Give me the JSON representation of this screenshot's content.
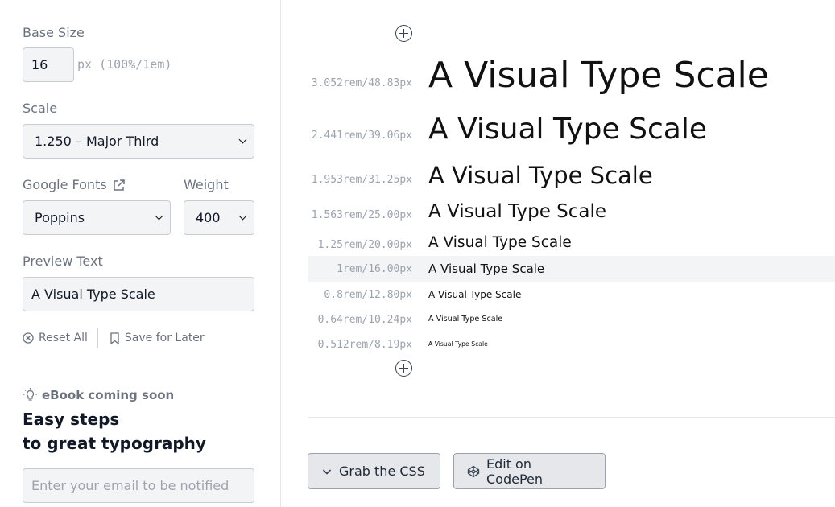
{
  "sidebar": {
    "base_size": {
      "label": "Base Size",
      "value": "16",
      "unit": "px (100%/1em)"
    },
    "scale": {
      "label": "Scale",
      "selected": "1.250 – Major Third"
    },
    "font": {
      "label": "Google Fonts",
      "selected": "Poppins"
    },
    "weight": {
      "label": "Weight",
      "selected": "400"
    },
    "preview": {
      "label": "Preview Text",
      "value": "A Visual Type Scale"
    },
    "actions": {
      "reset": "Reset All",
      "save": "Save for Later"
    },
    "ebook": {
      "badge": "eBook coming soon",
      "heading_line1": "Easy steps",
      "heading_line2": "to great typography",
      "email_placeholder": "Enter your email to be notified"
    }
  },
  "scale_rows": [
    {
      "size": "3.052rem/48.83px",
      "text": "A Visual Type Scale"
    },
    {
      "size": "2.441rem/39.06px",
      "text": "A Visual Type Scale"
    },
    {
      "size": "1.953rem/31.25px",
      "text": "A Visual Type Scale"
    },
    {
      "size": "1.563rem/25.00px",
      "text": "A Visual Type Scale"
    },
    {
      "size": "1.25rem/20.00px",
      "text": "A Visual Type Scale"
    },
    {
      "size": "1rem/16.00px",
      "text": "A Visual Type Scale"
    },
    {
      "size": "0.8rem/12.80px",
      "text": "A Visual Type Scale"
    },
    {
      "size": "0.64rem/10.24px",
      "text": "A Visual Type Scale"
    },
    {
      "size": "0.512rem/8.19px",
      "text": "A Visual Type Scale"
    }
  ],
  "buttons": {
    "grab_css": "Grab the CSS",
    "codepen": "Edit on CodePen"
  },
  "colors": {
    "accent": "#111827",
    "muted": "#6b7280",
    "field_bg": "#f3f4f6",
    "base_row_bg": "#f3f4f6"
  }
}
